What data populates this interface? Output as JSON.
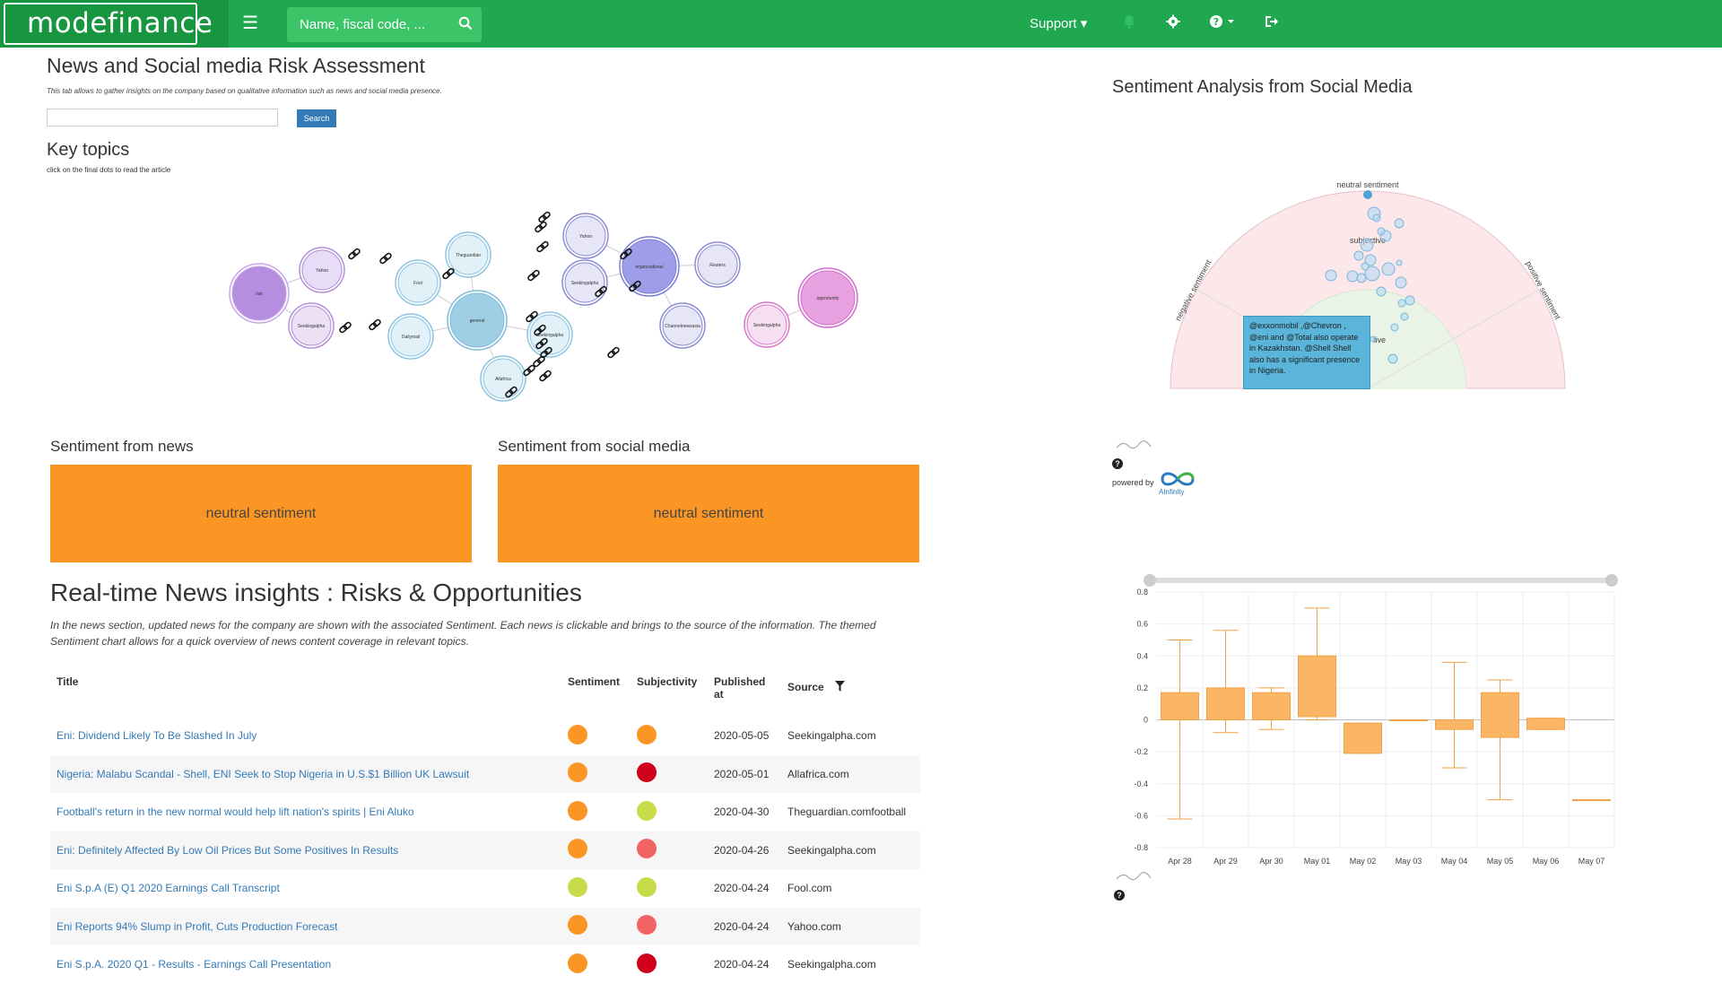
{
  "header": {
    "logo": "modefinance",
    "search_placeholder": "Name, fiscal code, ...",
    "support_label": "Support ▾",
    "colors": {
      "bar": "#1fa84f",
      "logo_bg": "#18963f"
    }
  },
  "main": {
    "title": "News and Social media Risk Assessment",
    "intro": "This tab allows to gather insights on the company based on qualitative information such as news and social media presence.",
    "search_button": "Search",
    "key_topics_title": "Key topics",
    "key_topics_sub": "click on the final dots to read the article",
    "topics": [
      {
        "label": "risk"
      },
      {
        "label": "Yahoo"
      },
      {
        "label": "Seekingalpha"
      },
      {
        "label": "Fool"
      },
      {
        "label": "Theguardian"
      },
      {
        "label": "Dailymail"
      },
      {
        "label": "general"
      },
      {
        "label": "Allafrica"
      },
      {
        "label": "Seekingalpha"
      },
      {
        "label": "Yahoo"
      },
      {
        "label": "Seekingalpha"
      },
      {
        "label": "organizational"
      },
      {
        "label": "Reuters"
      },
      {
        "label": "Channelnewsasia"
      },
      {
        "label": "Seekingalpha"
      },
      {
        "label": "opportunity"
      }
    ],
    "sentiment_news_title": "Sentiment from news",
    "sentiment_news_value": "neutral sentiment",
    "sentiment_social_title": "Sentiment from social media",
    "sentiment_social_value": "neutral sentiment",
    "realtime_title": "Real-time News insights : Risks & Opportunities",
    "realtime_desc": "In the news section, updated news for the company are shown with the associated Sentiment. Each news is clickable and brings to the source of the information. The themed Sentiment chart allows for a quick overview of news content coverage in relevant topics.",
    "table": {
      "headers": [
        "Title",
        "Sentiment",
        "Subjectivity",
        "Published at",
        "Source"
      ],
      "rows": [
        {
          "title": "Eni: Dividend Likely To Be Slashed In July",
          "sent": "#fb9625",
          "subj": "#fb9625",
          "date": "2020-05-05",
          "source": "Seekingalpha.com"
        },
        {
          "title": "Nigeria: Malabu Scandal - Shell, ENI Seek to Stop Nigeria in U.S.$1 Billion UK Lawsuit",
          "sent": "#fb9625",
          "subj": "#d0021b",
          "date": "2020-05-01",
          "source": "Allafrica.com"
        },
        {
          "title": "Football's return in the new normal would help lift nation's spirits | Eni Aluko",
          "sent": "#fb9625",
          "subj": "#c8dc4a",
          "date": "2020-04-30",
          "source": "Theguardian.comfootball"
        },
        {
          "title": "Eni: Definitely Affected By Low Oil Prices But Some Positives In Results",
          "sent": "#fb9625",
          "subj": "#f26464",
          "date": "2020-04-26",
          "source": "Seekingalpha.com"
        },
        {
          "title": "Eni S.p.A (E) Q1 2020 Earnings Call Transcript",
          "sent": "#c8dc4a",
          "subj": "#c8dc4a",
          "date": "2020-04-24",
          "source": "Fool.com"
        },
        {
          "title": "Eni Reports 94% Slump in Profit, Cuts Production Forecast",
          "sent": "#fb9625",
          "subj": "#f26464",
          "date": "2020-04-24",
          "source": "Yahoo.com"
        },
        {
          "title": "Eni S.p.A. 2020 Q1 - Results - Earnings Call Presentation",
          "sent": "#fb9625",
          "subj": "#d0021b",
          "date": "2020-04-24",
          "source": "Seekingalpha.com"
        }
      ]
    }
  },
  "right": {
    "title": "Sentiment Analysis from Social Media",
    "gauge_labels": {
      "neutral": "neutral sentiment",
      "negative": "negative sentiment",
      "positive": "positive sentiment",
      "subjective": "subjective",
      "objective": "tive"
    },
    "tooltip": "@exxonmobil ,@Chevron , @eni and @Total also operate in Kazakhstan. @Shell Shell also has a significant presence in Nigeria.",
    "powered_by": "powered by",
    "ainfinity": "AInfinity"
  },
  "chart_data": {
    "type": "box",
    "categories": [
      "Apr 28",
      "Apr 29",
      "Apr 30",
      "May 01",
      "May 02",
      "May 03",
      "May 04",
      "May 05",
      "May 06",
      "May 07"
    ],
    "ylim": [
      -0.8,
      0.8
    ],
    "yticks": [
      "0.8",
      "0.6",
      "0.4",
      "0.2",
      "0",
      "-0.2",
      "-0.4",
      "-0.6",
      "-0.8"
    ],
    "boxes": [
      {
        "low": -0.62,
        "q1": 0.0,
        "q3": 0.17,
        "high": 0.5
      },
      {
        "low": -0.08,
        "q1": 0.0,
        "q3": 0.2,
        "high": 0.56
      },
      {
        "low": -0.06,
        "q1": 0.0,
        "q3": 0.17,
        "high": 0.2
      },
      {
        "low": 0.0,
        "q1": 0.02,
        "q3": 0.4,
        "high": 0.7
      },
      {
        "low": -0.21,
        "q1": -0.21,
        "q3": -0.02,
        "high": -0.02
      },
      {
        "low": 0.0,
        "q1": 0.0,
        "q3": 0.0,
        "high": 0.0
      },
      {
        "low": -0.3,
        "q1": -0.06,
        "q3": 0.0,
        "high": 0.36
      },
      {
        "low": -0.5,
        "q1": -0.11,
        "q3": 0.17,
        "high": 0.25
      },
      {
        "low": -0.06,
        "q1": -0.06,
        "q3": 0.01,
        "high": 0.01
      },
      {
        "low": -0.5,
        "q1": -0.5,
        "q3": -0.5,
        "high": -0.5
      }
    ],
    "color": "#fbb665"
  }
}
